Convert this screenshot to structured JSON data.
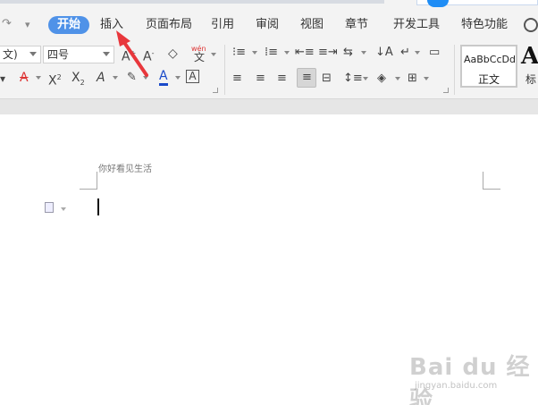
{
  "menu": {
    "tabs": [
      "开始",
      "插入",
      "页面布局",
      "引用",
      "审阅",
      "视图",
      "章节",
      "开发工具",
      "特色功能"
    ],
    "active": "开始"
  },
  "ribbon": {
    "font_name": "文)",
    "font_size": "四号",
    "phonetic_label": "wén",
    "phonetic_char": "文",
    "styles": [
      {
        "sample": "AaBbCcDd",
        "label": "正文"
      },
      {
        "sample": "Aa",
        "label": "标"
      }
    ]
  },
  "document": {
    "header_text": "你好看见生活"
  },
  "watermark": {
    "logo": "Bai du 经验",
    "url": "jingyan.baidu.com"
  },
  "colors": {
    "accent": "#4f92e8",
    "annotation_arrow": "#e8373c",
    "font_color_bar": "#1a4ac9"
  }
}
